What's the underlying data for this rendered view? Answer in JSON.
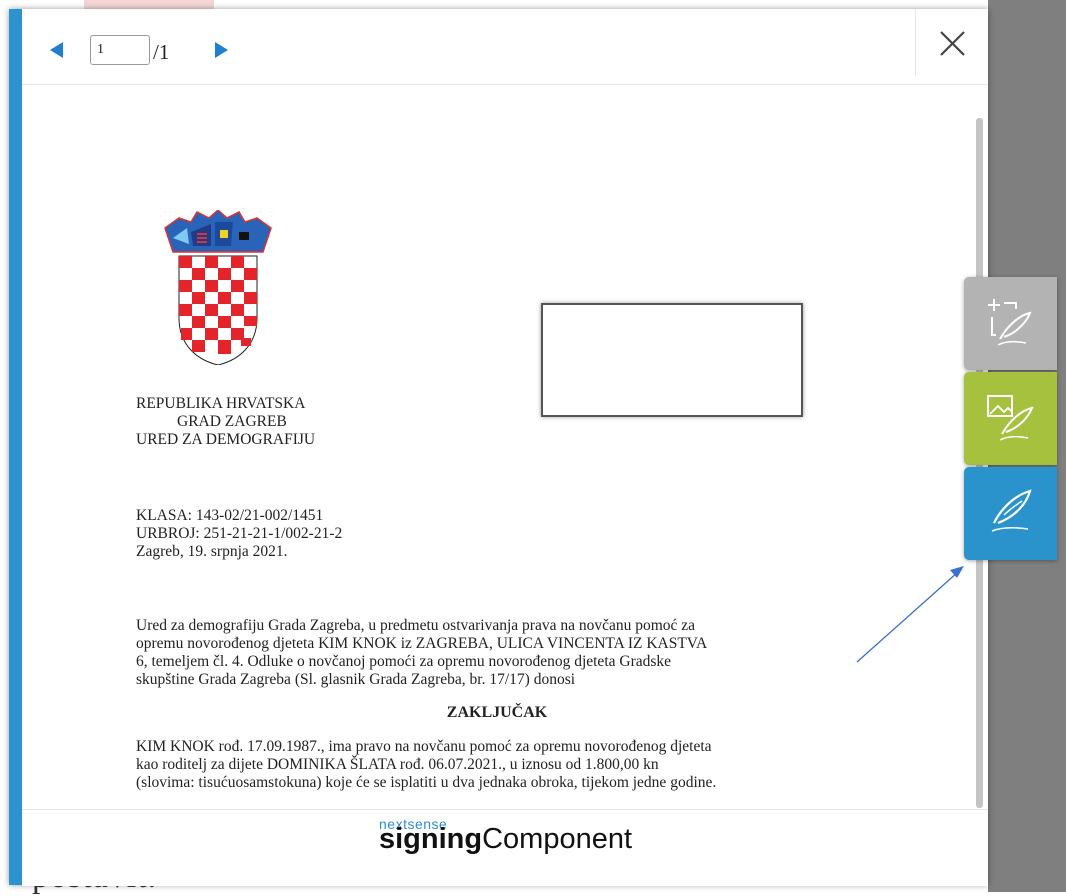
{
  "background": {
    "underlying_text": "postavit."
  },
  "toolbar": {
    "page_input": "1",
    "page_total": "/1",
    "prev_icon": "triangle-left",
    "next_icon": "triangle-right",
    "close_icon": "x"
  },
  "document": {
    "org_lines": [
      "REPUBLIKA HRVATSKA",
      "GRAD ZAGREB",
      "URED ZA DEMOGRAFIJU"
    ],
    "ref_lines": [
      "KLASA: 143-02/21-002/1451",
      "URBROJ: 251-21-21-1/002-21-2",
      "Zagreb, 19. srpnja 2021."
    ],
    "intro_lines": [
      "Ured za demografiju Grada Zagreba, u predmetu ostvarivanja prava na novčanu pomoć za",
      "opremu novorođenog djeteta KIM KNOK iz ZAGREBA, ULICA VINCENTA IZ KASTVA",
      "6, temeljem čl. 4. Odluke o novčanoj pomoći za opremu novorođenog djeteta Gradske",
      "skupštine Grada Zagreba (Sl. glasnik Grada Zagreba, br. 17/17) donosi"
    ],
    "heading": "ZAKLJUČAK",
    "body_lines": [
      "KIM KNOK rođ. 17.09.1987., ima pravo na novčanu pomoć za opremu novorođenog djeteta",
      "kao roditelj za dijete DOMINIKA ŠLATA rođ. 06.07.2021., u iznosu od 1.800,00 kn",
      "(slovima: tisućuosamstokuna) koje će se isplatiti u dva jednaka obroka, tijekom jedne godine."
    ]
  },
  "footer": {
    "brand_small": "nextsense",
    "brand_bold": "signing",
    "brand_regular": "Component"
  },
  "side_buttons": [
    {
      "icon": "add-signature-field-icon",
      "color": "#b3b3b3"
    },
    {
      "icon": "image-signature-icon",
      "color": "#a5c13d"
    },
    {
      "icon": "sign-icon",
      "color": "#2b93cc"
    }
  ],
  "colors": {
    "accent": "#2c93cf",
    "nav_arrow": "#1f7fd0"
  }
}
